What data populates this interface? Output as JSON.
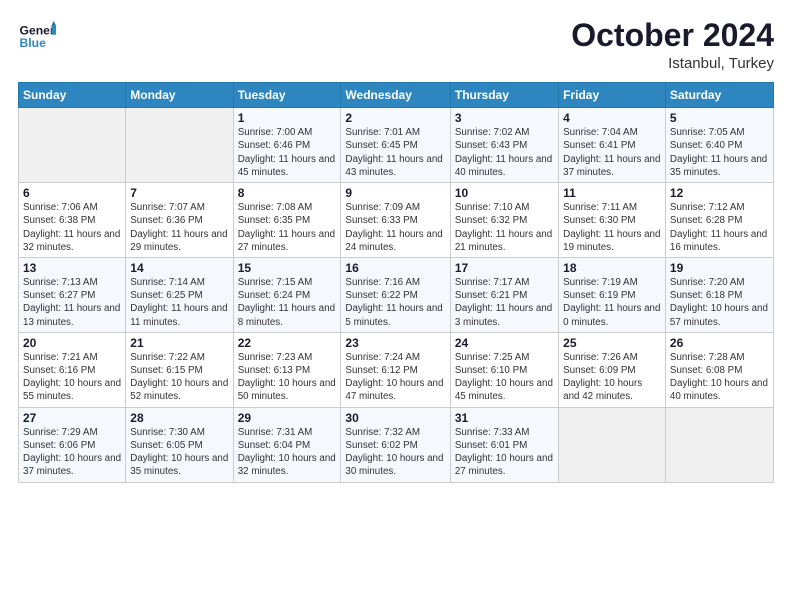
{
  "header": {
    "logo_line1": "General",
    "logo_line2": "Blue",
    "month": "October 2024",
    "location": "Istanbul, Turkey"
  },
  "weekdays": [
    "Sunday",
    "Monday",
    "Tuesday",
    "Wednesday",
    "Thursday",
    "Friday",
    "Saturday"
  ],
  "weeks": [
    [
      {
        "day": "",
        "sunrise": "",
        "sunset": "",
        "daylight": ""
      },
      {
        "day": "",
        "sunrise": "",
        "sunset": "",
        "daylight": ""
      },
      {
        "day": "1",
        "sunrise": "Sunrise: 7:00 AM",
        "sunset": "Sunset: 6:46 PM",
        "daylight": "Daylight: 11 hours and 45 minutes."
      },
      {
        "day": "2",
        "sunrise": "Sunrise: 7:01 AM",
        "sunset": "Sunset: 6:45 PM",
        "daylight": "Daylight: 11 hours and 43 minutes."
      },
      {
        "day": "3",
        "sunrise": "Sunrise: 7:02 AM",
        "sunset": "Sunset: 6:43 PM",
        "daylight": "Daylight: 11 hours and 40 minutes."
      },
      {
        "day": "4",
        "sunrise": "Sunrise: 7:04 AM",
        "sunset": "Sunset: 6:41 PM",
        "daylight": "Daylight: 11 hours and 37 minutes."
      },
      {
        "day": "5",
        "sunrise": "Sunrise: 7:05 AM",
        "sunset": "Sunset: 6:40 PM",
        "daylight": "Daylight: 11 hours and 35 minutes."
      }
    ],
    [
      {
        "day": "6",
        "sunrise": "Sunrise: 7:06 AM",
        "sunset": "Sunset: 6:38 PM",
        "daylight": "Daylight: 11 hours and 32 minutes."
      },
      {
        "day": "7",
        "sunrise": "Sunrise: 7:07 AM",
        "sunset": "Sunset: 6:36 PM",
        "daylight": "Daylight: 11 hours and 29 minutes."
      },
      {
        "day": "8",
        "sunrise": "Sunrise: 7:08 AM",
        "sunset": "Sunset: 6:35 PM",
        "daylight": "Daylight: 11 hours and 27 minutes."
      },
      {
        "day": "9",
        "sunrise": "Sunrise: 7:09 AM",
        "sunset": "Sunset: 6:33 PM",
        "daylight": "Daylight: 11 hours and 24 minutes."
      },
      {
        "day": "10",
        "sunrise": "Sunrise: 7:10 AM",
        "sunset": "Sunset: 6:32 PM",
        "daylight": "Daylight: 11 hours and 21 minutes."
      },
      {
        "day": "11",
        "sunrise": "Sunrise: 7:11 AM",
        "sunset": "Sunset: 6:30 PM",
        "daylight": "Daylight: 11 hours and 19 minutes."
      },
      {
        "day": "12",
        "sunrise": "Sunrise: 7:12 AM",
        "sunset": "Sunset: 6:28 PM",
        "daylight": "Daylight: 11 hours and 16 minutes."
      }
    ],
    [
      {
        "day": "13",
        "sunrise": "Sunrise: 7:13 AM",
        "sunset": "Sunset: 6:27 PM",
        "daylight": "Daylight: 11 hours and 13 minutes."
      },
      {
        "day": "14",
        "sunrise": "Sunrise: 7:14 AM",
        "sunset": "Sunset: 6:25 PM",
        "daylight": "Daylight: 11 hours and 11 minutes."
      },
      {
        "day": "15",
        "sunrise": "Sunrise: 7:15 AM",
        "sunset": "Sunset: 6:24 PM",
        "daylight": "Daylight: 11 hours and 8 minutes."
      },
      {
        "day": "16",
        "sunrise": "Sunrise: 7:16 AM",
        "sunset": "Sunset: 6:22 PM",
        "daylight": "Daylight: 11 hours and 5 minutes."
      },
      {
        "day": "17",
        "sunrise": "Sunrise: 7:17 AM",
        "sunset": "Sunset: 6:21 PM",
        "daylight": "Daylight: 11 hours and 3 minutes."
      },
      {
        "day": "18",
        "sunrise": "Sunrise: 7:19 AM",
        "sunset": "Sunset: 6:19 PM",
        "daylight": "Daylight: 11 hours and 0 minutes."
      },
      {
        "day": "19",
        "sunrise": "Sunrise: 7:20 AM",
        "sunset": "Sunset: 6:18 PM",
        "daylight": "Daylight: 10 hours and 57 minutes."
      }
    ],
    [
      {
        "day": "20",
        "sunrise": "Sunrise: 7:21 AM",
        "sunset": "Sunset: 6:16 PM",
        "daylight": "Daylight: 10 hours and 55 minutes."
      },
      {
        "day": "21",
        "sunrise": "Sunrise: 7:22 AM",
        "sunset": "Sunset: 6:15 PM",
        "daylight": "Daylight: 10 hours and 52 minutes."
      },
      {
        "day": "22",
        "sunrise": "Sunrise: 7:23 AM",
        "sunset": "Sunset: 6:13 PM",
        "daylight": "Daylight: 10 hours and 50 minutes."
      },
      {
        "day": "23",
        "sunrise": "Sunrise: 7:24 AM",
        "sunset": "Sunset: 6:12 PM",
        "daylight": "Daylight: 10 hours and 47 minutes."
      },
      {
        "day": "24",
        "sunrise": "Sunrise: 7:25 AM",
        "sunset": "Sunset: 6:10 PM",
        "daylight": "Daylight: 10 hours and 45 minutes."
      },
      {
        "day": "25",
        "sunrise": "Sunrise: 7:26 AM",
        "sunset": "Sunset: 6:09 PM",
        "daylight": "Daylight: 10 hours and 42 minutes."
      },
      {
        "day": "26",
        "sunrise": "Sunrise: 7:28 AM",
        "sunset": "Sunset: 6:08 PM",
        "daylight": "Daylight: 10 hours and 40 minutes."
      }
    ],
    [
      {
        "day": "27",
        "sunrise": "Sunrise: 7:29 AM",
        "sunset": "Sunset: 6:06 PM",
        "daylight": "Daylight: 10 hours and 37 minutes."
      },
      {
        "day": "28",
        "sunrise": "Sunrise: 7:30 AM",
        "sunset": "Sunset: 6:05 PM",
        "daylight": "Daylight: 10 hours and 35 minutes."
      },
      {
        "day": "29",
        "sunrise": "Sunrise: 7:31 AM",
        "sunset": "Sunset: 6:04 PM",
        "daylight": "Daylight: 10 hours and 32 minutes."
      },
      {
        "day": "30",
        "sunrise": "Sunrise: 7:32 AM",
        "sunset": "Sunset: 6:02 PM",
        "daylight": "Daylight: 10 hours and 30 minutes."
      },
      {
        "day": "31",
        "sunrise": "Sunrise: 7:33 AM",
        "sunset": "Sunset: 6:01 PM",
        "daylight": "Daylight: 10 hours and 27 minutes."
      },
      {
        "day": "",
        "sunrise": "",
        "sunset": "",
        "daylight": ""
      },
      {
        "day": "",
        "sunrise": "",
        "sunset": "",
        "daylight": ""
      }
    ]
  ]
}
